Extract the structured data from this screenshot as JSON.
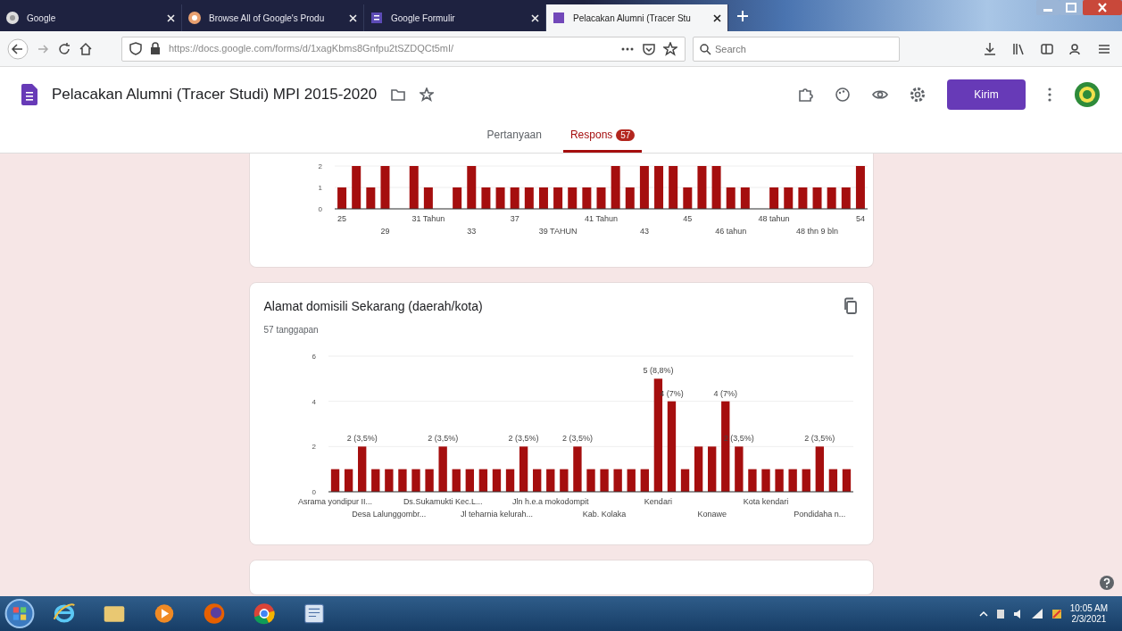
{
  "browser": {
    "tabs": [
      {
        "title": "Google",
        "selected": false
      },
      {
        "title": "Browse All of Google's Produ",
        "selected": false
      },
      {
        "title": "Google Formulir",
        "selected": false
      },
      {
        "title": "Pelacakan Alumni (Tracer Stu",
        "selected": true
      }
    ],
    "address": "https://docs.google.com/forms/d/1xagKbms8Gnfpu2tSZDQCt5mI/",
    "search": {
      "placeholder": "Search"
    }
  },
  "form": {
    "title": "Pelacakan Alumni (Tracer Studi) MPI 2015-2020",
    "send_button": "Kirim",
    "tabs": [
      {
        "label": "Pertanyaan",
        "selected": false
      },
      {
        "label": "Respons",
        "selected": true,
        "badge": "57"
      }
    ]
  },
  "cards": [
    {
      "chart_data": {
        "type": "bar",
        "ylim": [
          0,
          2
        ],
        "yticks": [
          0,
          1,
          2
        ],
        "values": [
          1,
          2,
          1,
          2,
          null,
          2,
          1,
          null,
          1,
          2,
          1,
          1,
          1,
          1,
          1,
          1,
          1,
          1,
          1,
          2,
          1,
          2,
          2,
          2,
          1,
          2,
          2,
          1,
          1,
          null,
          1,
          1,
          1,
          1,
          1,
          1,
          2
        ],
        "categories": [
          "25",
          null,
          null,
          "29",
          null,
          null,
          "31 Tahun",
          null,
          null,
          "33",
          null,
          null,
          "37",
          null,
          null,
          "39 TAHUN",
          null,
          null,
          "41 Tahun",
          null,
          null,
          "43",
          null,
          null,
          "45",
          null,
          null,
          "46 tahun",
          null,
          null,
          "48 tahun",
          null,
          null,
          "48 thn 9 bln",
          null,
          null,
          "54"
        ]
      }
    },
    {
      "title": "Alamat domisili Sekarang (daerah/kota)",
      "subtitle": "57 tanggapan",
      "chart_data": {
        "type": "bar",
        "ylim": [
          0,
          6
        ],
        "yticks": [
          0,
          2,
          4,
          6
        ],
        "values": [
          1,
          1,
          2,
          1,
          1,
          1,
          1,
          1,
          2,
          1,
          1,
          1,
          1,
          1,
          2,
          1,
          1,
          1,
          2,
          1,
          1,
          1,
          1,
          1,
          5,
          4,
          1,
          2,
          2,
          4,
          2,
          1,
          1,
          1,
          1,
          1,
          2,
          1,
          1
        ],
        "value_labels": [
          null,
          null,
          "2 (3,5%)",
          null,
          null,
          null,
          null,
          null,
          "2 (3,5%)",
          null,
          null,
          null,
          null,
          null,
          "2 (3,5%)",
          null,
          null,
          null,
          "2 (3,5%)",
          null,
          null,
          null,
          null,
          null,
          "5 (8,8%)",
          "4 (7%)",
          null,
          null,
          null,
          "4 (7%)",
          "2 (3,5%)",
          null,
          null,
          null,
          null,
          null,
          "2 (3,5%)",
          null,
          null
        ],
        "categories": [
          "Asrama yondipur II...",
          null,
          null,
          null,
          "Desa Lalunggombr...",
          null,
          null,
          null,
          "Ds.Sukamukti Kec.L...",
          null,
          null,
          null,
          "Jl teharnia kelurah...",
          null,
          null,
          null,
          "Jln h.e.a mokodompit",
          null,
          null,
          null,
          "Kab. Kolaka",
          null,
          null,
          null,
          "Kendari",
          null,
          null,
          null,
          "Konawe",
          null,
          null,
          null,
          "Kota kendari",
          null,
          null,
          null,
          "Pondidaha n...",
          null,
          null
        ]
      }
    }
  ],
  "taskbar": {
    "time": "10:05 AM",
    "date": "2/3/2021"
  }
}
